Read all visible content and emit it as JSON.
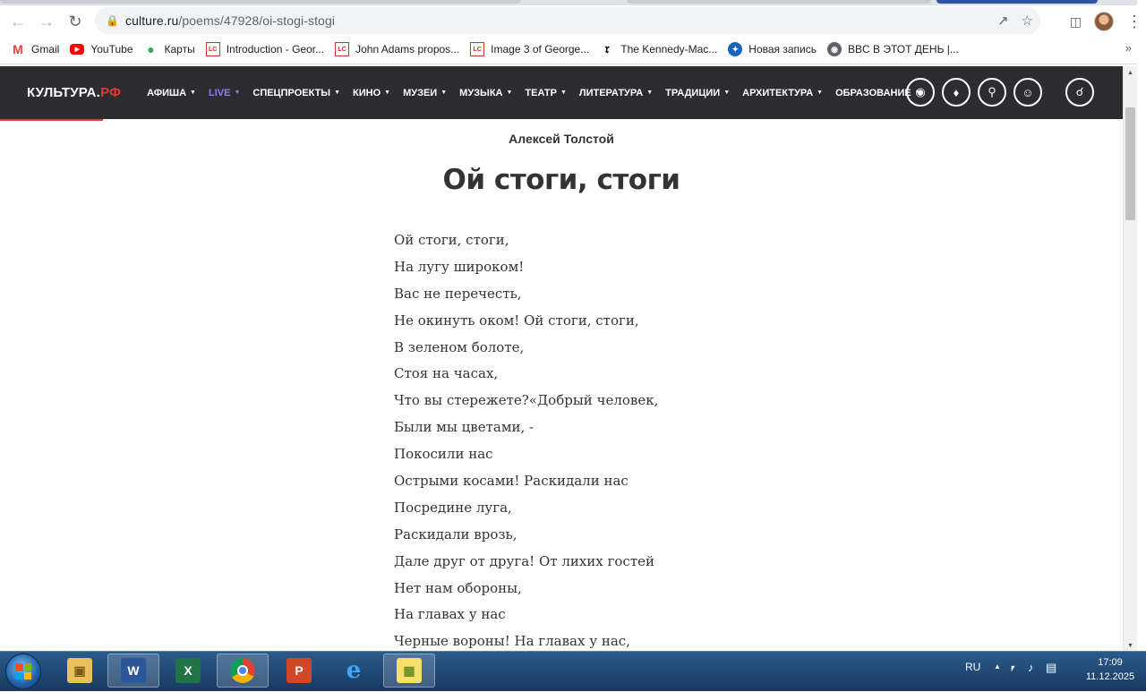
{
  "browser": {
    "url_host": "culture.ru",
    "url_path": "/poems/47928/oi-stogi-stogi",
    "bookmarks": [
      {
        "label": "Gmail",
        "icon": "gmail-icon"
      },
      {
        "label": "YouTube",
        "icon": "youtube-icon"
      },
      {
        "label": "Карты",
        "icon": "maps-icon"
      },
      {
        "label": "Introduction - Geor...",
        "icon": "loc-icon"
      },
      {
        "label": "John Adams propos...",
        "icon": "loc-icon"
      },
      {
        "label": "Image 3 of George...",
        "icon": "loc-icon"
      },
      {
        "label": "The Kennedy-Mac...",
        "icon": "nyt-icon"
      },
      {
        "label": "Новая запись",
        "icon": "bird-icon"
      },
      {
        "label": "BBC В ЭТОТ ДЕНЬ |...",
        "icon": "globe-icon"
      }
    ],
    "bookmarks_more": "»"
  },
  "site": {
    "logo_main": "КУЛЬТУРА.",
    "logo_rf": "РФ",
    "menu": [
      {
        "label": "АФИША"
      },
      {
        "label": "LIVE"
      },
      {
        "label": "СПЕЦПРОЕКТЫ"
      },
      {
        "label": "КИНО"
      },
      {
        "label": "МУЗЕИ"
      },
      {
        "label": "МУЗЫКА"
      },
      {
        "label": "ТЕАТР"
      },
      {
        "label": "ЛИТЕРАТУРА"
      },
      {
        "label": "ТРАДИЦИИ"
      },
      {
        "label": "АРХИТЕКТУРА"
      },
      {
        "label": "ОБРАЗОВАНИЕ"
      }
    ],
    "accent_color": "#e53935",
    "live_color": "#8f7bff"
  },
  "article": {
    "author": "Алексей Толстой",
    "title": "Ой стоги, стоги",
    "lines": [
      "Ой стоги, стоги,",
      "На лугу широком!",
      "Вас не перечесть,",
      "Не окинуть оком! Ой стоги, стоги,",
      "В зеленом болоте,",
      "Стоя на часах,",
      "Что вы стережете?«Добрый человек,",
      "Были мы цветами, -",
      "Покосили нас",
      "Острыми косами! Раскидали нас",
      "Посредине луга,",
      "Раскидали врозь,",
      "Дале друг от друга! От лихих гостей",
      "Нет нам обороны,",
      "На главах у нас",
      "Черные вороны! На главах у нас,"
    ]
  },
  "taskbar": {
    "apps": [
      {
        "name": "explorer",
        "icon": "folder-icon"
      },
      {
        "name": "word",
        "icon": "word-icon"
      },
      {
        "name": "excel",
        "icon": "excel-icon"
      },
      {
        "name": "chrome",
        "icon": "chrome-icon"
      },
      {
        "name": "powerpoint",
        "icon": "powerpoint-icon"
      },
      {
        "name": "ie",
        "icon": "ie-icon"
      },
      {
        "name": "notes",
        "icon": "notes-icon"
      }
    ],
    "lang": "RU",
    "time": "17:09",
    "date": "11.12.2025"
  }
}
